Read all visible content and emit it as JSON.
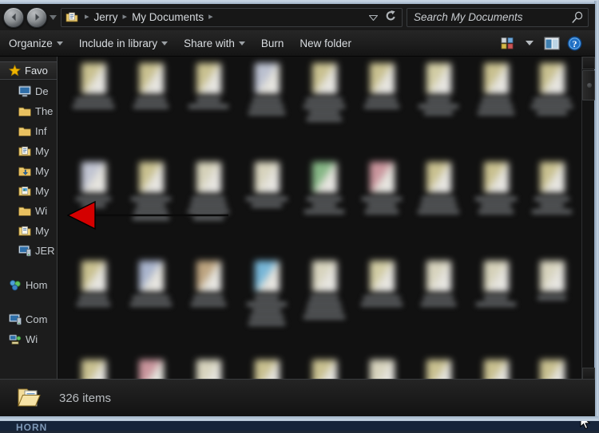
{
  "window": {
    "title": "My Documents",
    "frame_color": "#b4c4d6",
    "background": "#0e0e0e"
  },
  "navbar": {
    "back_button": {
      "icon": "back-arrow-icon",
      "label": "Back"
    },
    "forward_button": {
      "icon": "forward-arrow-icon",
      "label": "Forward"
    },
    "history_dropdown": {
      "icon": "chevron-down-icon"
    },
    "address": {
      "folder_icon": "documents-folder-icon",
      "breadcrumbs": [
        "Jerry",
        "My Documents"
      ],
      "separator": "▸",
      "dropdown_icon": "chevron-down-icon",
      "refresh_icon": "refresh-icon"
    },
    "search": {
      "placeholder": "Search My Documents",
      "value": "",
      "icon": "search-icon"
    }
  },
  "toolbar": {
    "items": [
      {
        "label": "Organize",
        "has_caret": true
      },
      {
        "label": "Include in library",
        "has_caret": true
      },
      {
        "label": "Share with",
        "has_caret": true
      },
      {
        "label": "Burn",
        "has_caret": false
      },
      {
        "label": "New folder",
        "has_caret": false
      }
    ],
    "view_button": {
      "icon": "view-options-icon",
      "caret": "chevron-down-icon"
    },
    "preview_pane_button": {
      "icon": "preview-pane-icon"
    },
    "help_button": {
      "icon": "help-icon",
      "color": "#1f6fc4"
    }
  },
  "sidebar": {
    "header": {
      "label": "Favo",
      "full_label": "Favorites",
      "icon": "star-icon",
      "color": "#f0b400"
    },
    "items": [
      {
        "label": "De",
        "full_label": "Desktop",
        "icon": "desktop-icon"
      },
      {
        "label": "The",
        "full_label": "Themes",
        "icon": "folder-icon"
      },
      {
        "label": "Inf",
        "full_label": "Info",
        "icon": "folder-icon"
      },
      {
        "label": "My",
        "full_label": "My Documents",
        "icon": "documents-folder-icon"
      },
      {
        "label": "My",
        "full_label": "My Downloads",
        "icon": "downloads-folder-icon"
      },
      {
        "label": "My",
        "full_label": "My Pictures",
        "icon": "pictures-folder-icon"
      },
      {
        "label": "Wi",
        "full_label": "Windows",
        "icon": "folder-icon"
      },
      {
        "label": "My",
        "full_label": "My Stuff",
        "icon": "documents-folder-icon"
      },
      {
        "label": "JER",
        "full_label": "JERRY-PC",
        "icon": "computer-icon"
      }
    ],
    "group_homegroup": {
      "label": "Hom",
      "full_label": "Homegroup",
      "icon": "homegroup-icon"
    },
    "group_computer": {
      "label": "Com",
      "full_label": "Computer",
      "icon": "computer-icon"
    },
    "group_network": {
      "label": "Wi",
      "full_label": "Windows",
      "icon": "network-icon"
    }
  },
  "content": {
    "view_mode": "medium-icons",
    "columns": 9,
    "rows": 4,
    "blurred": true,
    "icon_tints": [
      [
        "#d8cf9a",
        "#d8cf9a",
        "#d8cf9a",
        "#c9cfe0",
        "#d8cf9a",
        "#d8cf9a",
        "#e2dcb0",
        "#d8cf9a",
        "#d8cf9a"
      ],
      [
        "#cfd3e2",
        "#d8cf9a",
        "#e6e2c8",
        "#e8e4cc",
        "#8fc48f",
        "#d9a0a8",
        "#d8cf9a",
        "#d8cf9a",
        "#d8cf9a"
      ],
      [
        "#d8cf9a",
        "#b6c2dd",
        "#cbb089",
        "#7fc4e8",
        "#e8e4cc",
        "#e2dcb0",
        "#e8e4cc",
        "#e6e2c8",
        "#e8e4cc"
      ],
      [
        "#d8cf9a",
        "#d9a0a8",
        "#e8e4cc",
        "#d8cf9a",
        "#d8cf9a",
        "#e8e4cc",
        "#d8cf9a",
        "#d8cf9a",
        "#d8cf9a"
      ]
    ],
    "label_line_counts": [
      [
        2,
        2,
        2,
        3,
        4,
        2,
        3,
        3,
        3
      ],
      [
        2,
        4,
        4,
        2,
        3,
        3,
        3,
        3,
        3
      ],
      [
        2,
        2,
        2,
        5,
        4,
        2,
        2,
        2,
        1
      ],
      [
        1,
        1,
        1,
        1,
        1,
        1,
        1,
        1,
        1
      ]
    ]
  },
  "scrollbar": {
    "up_icon": "scroll-up-icon",
    "down_icon": "scroll-down-icon",
    "thumb_position_pct": 4
  },
  "statusbar": {
    "icon": "open-folder-icon",
    "text": "326 items"
  },
  "annotation": {
    "type": "arrow",
    "color": "#d40000",
    "line_color": "#0a0a0a",
    "direction": "left",
    "points_at": "sidebar-item-windows"
  },
  "desktop": {
    "background_top": "#20344a",
    "bottom_label": "HORN",
    "cursor_icon": "mouse-pointer-icon"
  }
}
